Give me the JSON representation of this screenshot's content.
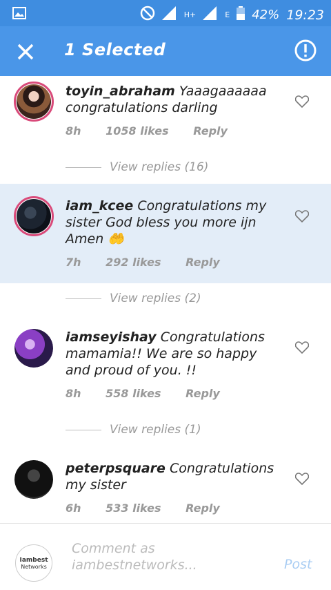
{
  "statusbar": {
    "battery": "42%",
    "time": "19:23",
    "network_h": "H+",
    "network_e": "E"
  },
  "appbar": {
    "title": "1 Selected"
  },
  "comments": [
    {
      "user": "toyin_abraham",
      "text": "Yaaagaaaaaa congratulations darling",
      "time": "8h",
      "likes": "1058 likes",
      "reply": "Reply",
      "view_replies": "View replies (16)",
      "selected": false
    },
    {
      "user": "iam_kcee",
      "text": "Congratulations my sister God bless you more ijn Amen 🤲",
      "time": "7h",
      "likes": "292 likes",
      "reply": "Reply",
      "view_replies": "View replies (2)",
      "selected": true
    },
    {
      "user": "iamseyishay",
      "text": "Congratulations mamamia!! We are so happy and proud of you. !!",
      "time": "8h",
      "likes": "558 likes",
      "reply": "Reply",
      "view_replies": "View replies (1)",
      "selected": false
    },
    {
      "user": "peterpsquare",
      "text": "Congratulations my sister",
      "time": "6h",
      "likes": "533 likes",
      "reply": "Reply",
      "selected": false
    }
  ],
  "composer": {
    "placeholder": "Comment as iambestnetworks...",
    "post": "Post",
    "avatar_text_top": "Iambest",
    "avatar_text_bottom": "Networks"
  },
  "colors": {
    "statusbar": "#3f8de0",
    "appbar": "#4a96e8",
    "selected_bg": "#e3edf8",
    "muted": "#999999",
    "post_disabled": "#a9cdf3"
  }
}
